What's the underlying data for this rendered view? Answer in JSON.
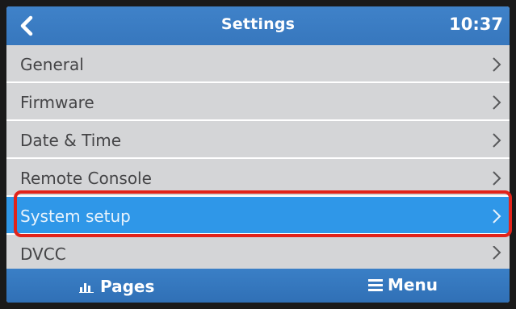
{
  "header": {
    "back_icon": "chevron-left-icon",
    "title": "Settings",
    "time": "10:37"
  },
  "menu_items": [
    {
      "label": "General",
      "icon": "chevron-right-icon"
    },
    {
      "label": "Firmware",
      "icon": "chevron-right-icon"
    },
    {
      "label": "Date & Time",
      "icon": "chevron-right-icon"
    },
    {
      "label": "Remote Console",
      "icon": "chevron-right-icon"
    },
    {
      "label": "System setup",
      "icon": "chevron-right-icon",
      "selected": true,
      "highlighted": true
    },
    {
      "label": "DVCC",
      "icon": "chevron-right-icon"
    }
  ],
  "footer": {
    "pages_label": "Pages",
    "pages_icon": "bar-chart-icon",
    "menu_label": "Menu",
    "menu_icon": "hamburger-icon"
  },
  "colors": {
    "header_bg": "#3a7cc2",
    "selected_bg": "#2f97e8",
    "list_bg": "#d4d5d7",
    "list_text": "#454547",
    "highlight_border": "#e2231a"
  }
}
